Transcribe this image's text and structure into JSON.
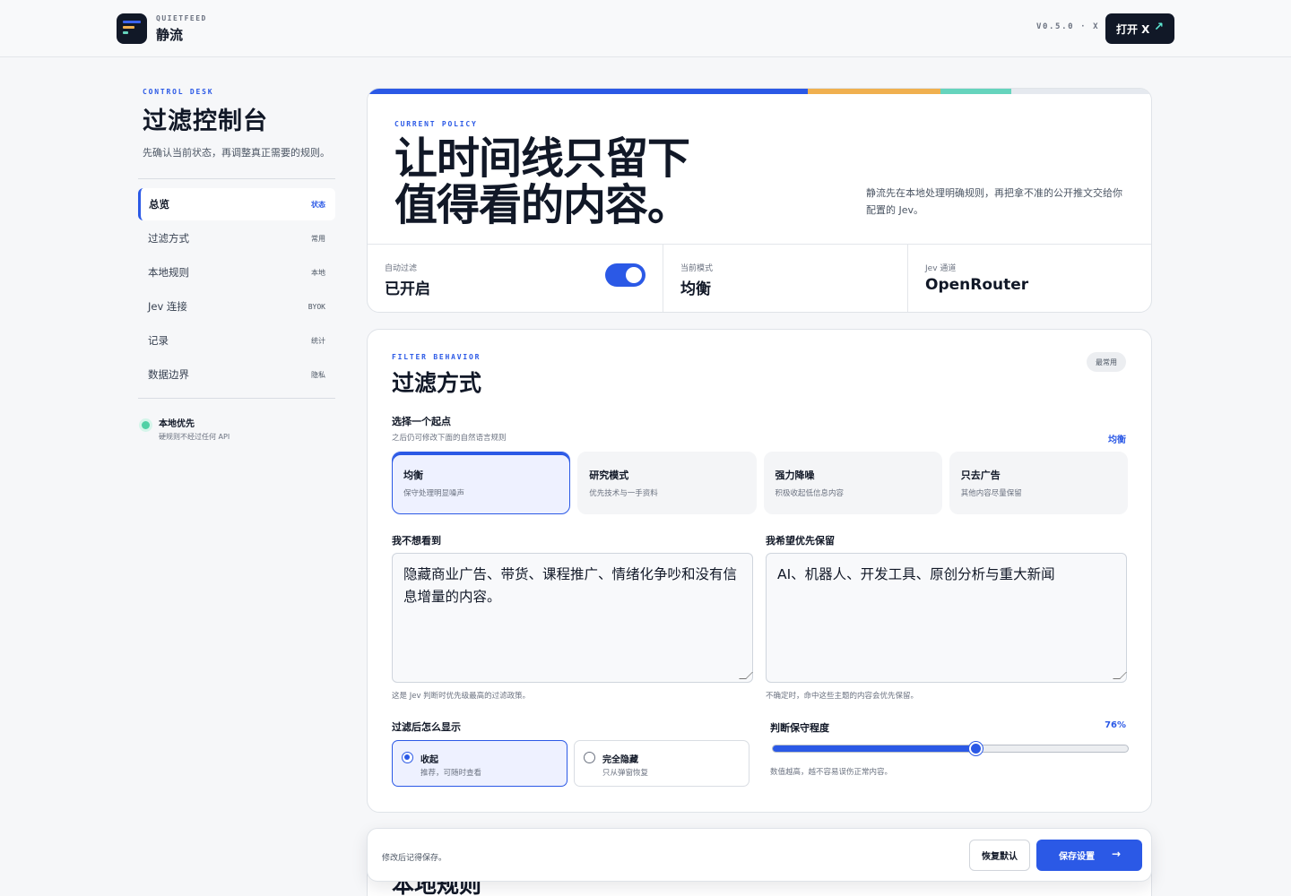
{
  "header": {
    "brand_sub": "QUIETFEED",
    "brand_name": "静流",
    "version": "V0.5.0 · X",
    "open_button": "打开 X",
    "open_icon": "↗"
  },
  "sidebar": {
    "eyebrow": "CONTROL DESK",
    "title": "过滤控制台",
    "desc": "先确认当前状态，再调整真正需要的规则。",
    "items": [
      {
        "label": "总览",
        "tag": "状态"
      },
      {
        "label": "过滤方式",
        "tag": "常用"
      },
      {
        "label": "本地规则",
        "tag": "本地"
      },
      {
        "label": "Jev 连接",
        "tag": "BYOK"
      },
      {
        "label": "记录",
        "tag": "统计"
      },
      {
        "label": "数据边界",
        "tag": "隐私"
      }
    ],
    "local": {
      "title": "本地优先",
      "sub": "硬规则不经过任何 API"
    }
  },
  "hero": {
    "eyebrow": "CURRENT POLICY",
    "title_line1": "让时间线只留下",
    "title_line2": "值得看的内容。",
    "note": "静流先在本地处理明确规则，再把拿不准的公开推文交给你配置的 Jev。",
    "auto_label": "自动过滤",
    "auto_value": "已开启",
    "auto_on": true,
    "mode_label": "当前模式",
    "mode_value": "均衡",
    "channel_label": "Jev 通道",
    "channel_value": "OpenRouter"
  },
  "filter": {
    "eyebrow": "FILTER BEHAVIOR",
    "title": "过滤方式",
    "pill": "最常用",
    "pick_label": "选择一个起点",
    "pick_sub": "之后仍可修改下面的自然语言规则",
    "pick_value": "均衡",
    "presets": [
      {
        "name": "均衡",
        "desc": "保守处理明显噪声",
        "selected": true
      },
      {
        "name": "研究模式",
        "desc": "优先技术与一手资料",
        "selected": false
      },
      {
        "name": "强力降噪",
        "desc": "积极收起低信息内容",
        "selected": false
      },
      {
        "name": "只去广告",
        "desc": "其他内容尽量保留",
        "selected": false
      }
    ],
    "block_label": "我不想看到",
    "block_text": "隐藏商业广告、带货、课程推广、情绪化争吵和没有信息增量的内容。",
    "block_help": "这是 Jev 判断时优先级最高的过滤政策。",
    "keep_label": "我希望优先保留",
    "keep_text": "AI、机器人、开发工具、原创分析与重大新闻",
    "keep_help": "不确定时，命中这些主题的内容会优先保留。",
    "display_label": "过滤后怎么显示",
    "display_options": [
      {
        "name": "收起",
        "desc": "推荐，可随时查看",
        "selected": true
      },
      {
        "name": "完全隐藏",
        "desc": "只从弹窗恢复",
        "selected": false
      }
    ],
    "threshold_label": "判断保守程度",
    "threshold_value": "76%",
    "threshold_fraction": 0.57,
    "threshold_help": "数值越高，越不容易误伤正常内容。"
  },
  "next_section": {
    "title": "本地规则"
  },
  "savebar": {
    "hint": "修改后记得保存。",
    "reset": "恢复默认",
    "save": "保存设置",
    "save_icon": "→"
  },
  "colors": {
    "accent": "#2b59e6",
    "strip": [
      "#2b59e6",
      "#f0b04f",
      "#66d4bd",
      "#e5e9ef"
    ],
    "dark": "#111827",
    "local_dot": "#4fd1a5"
  }
}
